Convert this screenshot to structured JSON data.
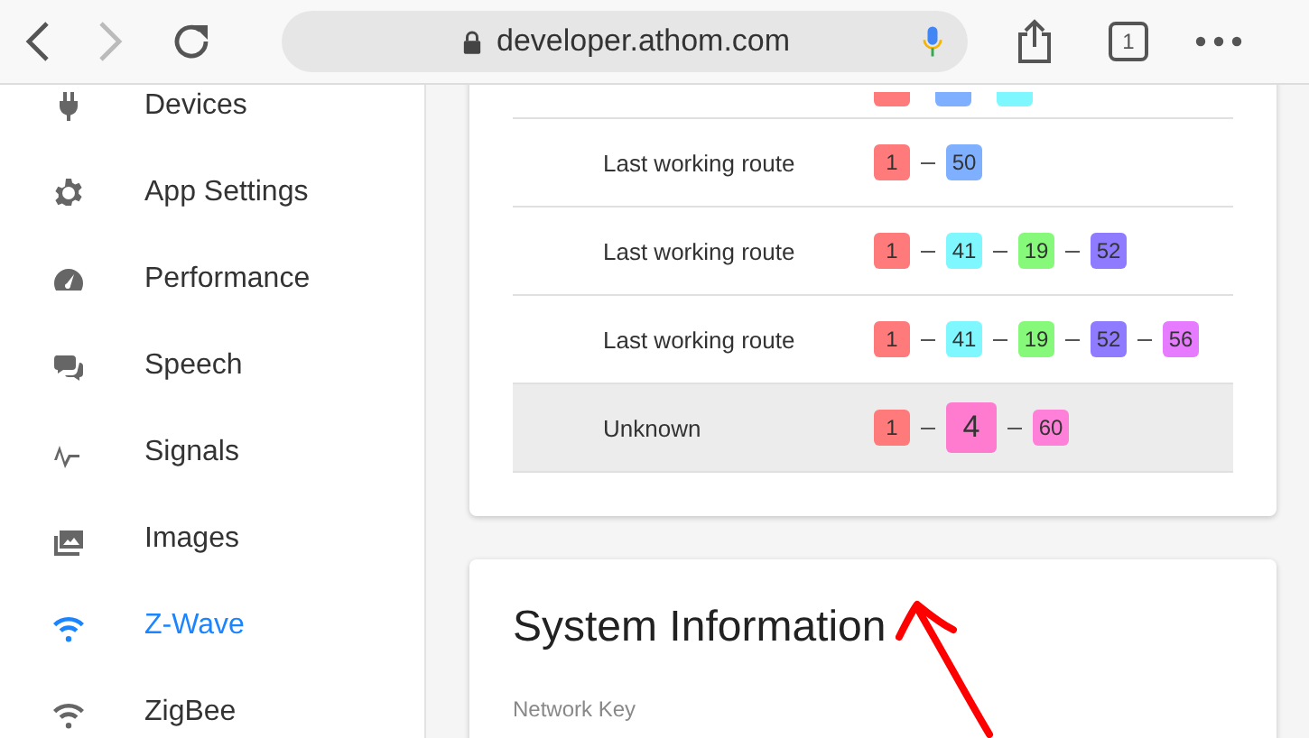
{
  "toolbar": {
    "back_disabled": false,
    "forward_disabled": true,
    "url": "developer.athom.com",
    "tab_count": "1"
  },
  "sidebar": {
    "items": [
      {
        "label": "Devices",
        "selected": false
      },
      {
        "label": "App Settings",
        "selected": false
      },
      {
        "label": "Performance",
        "selected": false
      },
      {
        "label": "Speech",
        "selected": false
      },
      {
        "label": "Signals",
        "selected": false
      },
      {
        "label": "Images",
        "selected": false
      },
      {
        "label": "Z-Wave",
        "selected": true
      },
      {
        "label": "ZigBee",
        "selected": false
      }
    ]
  },
  "routes": [
    {
      "label": "Last working route",
      "selected": false,
      "nodes": [
        {
          "text": "1",
          "color": "#ff7b7b",
          "kind": "normal"
        },
        {
          "text": "50",
          "color": "#7fb0ff",
          "kind": "normal"
        }
      ]
    },
    {
      "label": "Last working route",
      "selected": false,
      "nodes": [
        {
          "text": "1",
          "color": "#ff7b7b",
          "kind": "normal"
        },
        {
          "text": "41",
          "color": "#7ff7ff",
          "kind": "normal"
        },
        {
          "text": "19",
          "color": "#87f97a",
          "kind": "normal"
        },
        {
          "text": "52",
          "color": "#8f7bff",
          "kind": "normal"
        }
      ]
    },
    {
      "label": "Last working route",
      "selected": false,
      "nodes": [
        {
          "text": "1",
          "color": "#ff7b7b",
          "kind": "normal"
        },
        {
          "text": "41",
          "color": "#7ff7ff",
          "kind": "normal"
        },
        {
          "text": "19",
          "color": "#87f97a",
          "kind": "normal"
        },
        {
          "text": "52",
          "color": "#8f7bff",
          "kind": "normal"
        },
        {
          "text": "56",
          "color": "#e77bff",
          "kind": "normal"
        }
      ]
    },
    {
      "label": "Unknown",
      "selected": true,
      "nodes": [
        {
          "text": "1",
          "color": "#ff7b7b",
          "kind": "normal"
        },
        {
          "text": "4",
          "color": "#ff7bd0",
          "kind": "large"
        },
        {
          "text": "60",
          "color": "#ff80d8",
          "kind": "normal"
        }
      ]
    }
  ],
  "system_info": {
    "title": "System Information",
    "field_label": "Network Key"
  }
}
